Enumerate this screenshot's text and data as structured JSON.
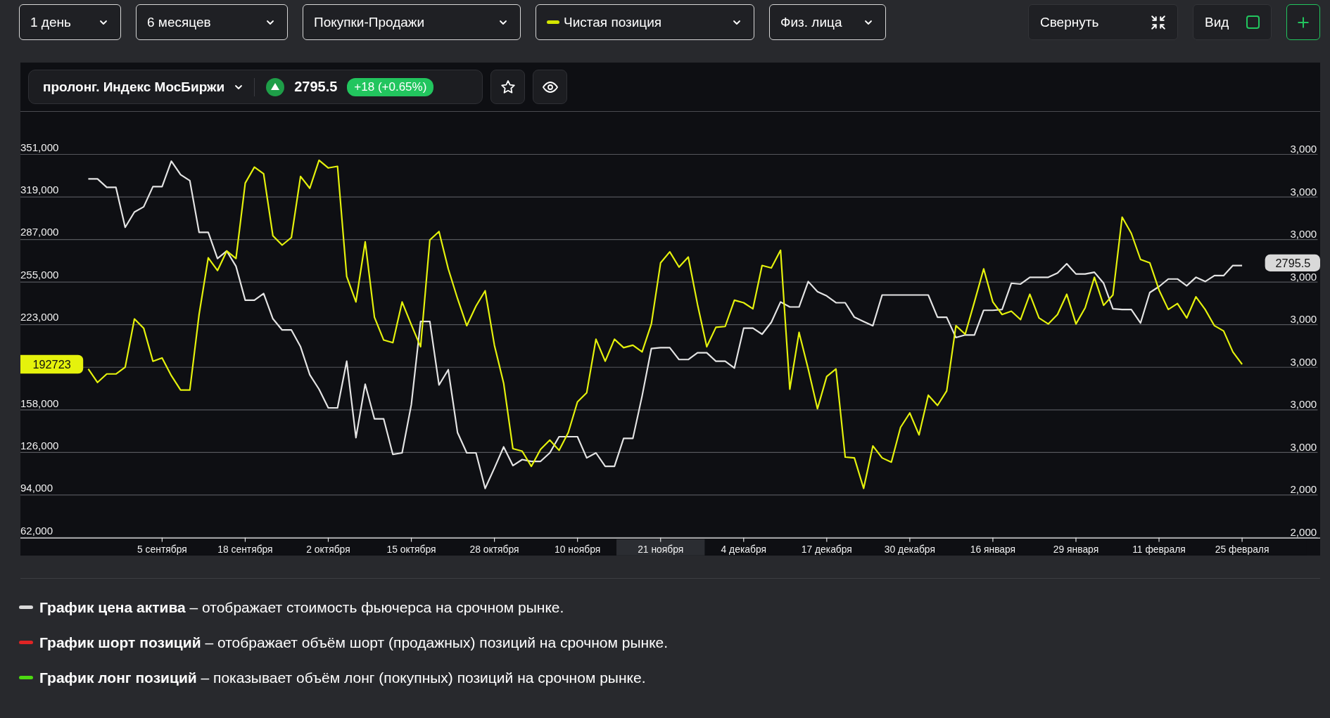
{
  "toolbar": {
    "filters": [
      {
        "label": "1 день",
        "kind": "plain"
      },
      {
        "label": "6 месяцев",
        "kind": "plain"
      },
      {
        "label": "Покупки-Продажи",
        "kind": "plain"
      },
      {
        "label": "Чистая позиция",
        "kind": "series",
        "color": "#d4e600"
      },
      {
        "label": "Физ. лица",
        "kind": "plain"
      }
    ],
    "collapse_button": {
      "label": "Свернуть"
    },
    "view_toggle": {
      "label": "Вид",
      "checked": false
    }
  },
  "instrument": {
    "name": "пролонг. Индекс МосБиржи",
    "rising": true,
    "price": "2795.5",
    "change": "+18 (+0.65%)"
  },
  "chart": {
    "chart_data": {
      "type": "line",
      "grid": true,
      "ylim": [
        62000,
        351000
      ],
      "categories": [
        null,
        null,
        null,
        null,
        null,
        null,
        null,
        null,
        "5 сентября",
        null,
        null,
        null,
        null,
        null,
        null,
        null,
        null,
        "18 сентября",
        null,
        null,
        null,
        null,
        null,
        null,
        null,
        null,
        "2 октября",
        null,
        null,
        null,
        null,
        null,
        null,
        null,
        null,
        "15 октября",
        null,
        null,
        null,
        null,
        null,
        null,
        null,
        null,
        "28 октября",
        null,
        null,
        null,
        null,
        null,
        null,
        null,
        null,
        "10 ноября",
        null,
        null,
        null,
        null,
        null,
        null,
        null,
        null,
        "21 ноября",
        null,
        null,
        null,
        null,
        null,
        null,
        null,
        null,
        "4 декабря",
        null,
        null,
        null,
        null,
        null,
        null,
        null,
        null,
        "17 декабря",
        null,
        null,
        null,
        null,
        null,
        null,
        null,
        null,
        "30 декабря",
        null,
        null,
        null,
        null,
        null,
        null,
        null,
        null,
        "16 января",
        null,
        null,
        null,
        null,
        null,
        null,
        null,
        null,
        "29 января",
        null,
        null,
        null,
        null,
        null,
        null,
        null,
        null,
        "11 февраля",
        null,
        null,
        null,
        null,
        null,
        null,
        null,
        null,
        "25 февраля"
      ],
      "yticks": [
        {
          "value": 351000,
          "label": "351,000"
        },
        {
          "value": 319000,
          "label": "319,000"
        },
        {
          "value": 287000,
          "label": "287,000"
        },
        {
          "value": 255000,
          "label": "255,000"
        },
        {
          "value": 223000,
          "label": "223,000"
        },
        {
          "value": 158000,
          "label": "158,000"
        },
        {
          "value": 126000,
          "label": "126,000"
        },
        {
          "value": 94000,
          "label": "94,000"
        },
        {
          "value": 62000,
          "label": "62,000"
        }
      ],
      "series": [
        {
          "color": "#e4e4e4",
          "values": [
            332500,
            332500,
            326100,
            326100,
            296000,
            307500,
            311400,
            326700,
            326700,
            345900,
            335700,
            331200,
            292200,
            292200,
            272400,
            278100,
            266600,
            241000,
            241000,
            246100,
            227000,
            218600,
            218600,
            205900,
            184800,
            173900,
            159800,
            159800,
            195000,
            137400,
            177700,
            151500,
            151500,
            124700,
            125900,
            162400,
            225000,
            225000,
            177100,
            188600,
            141300,
            125900,
            125900,
            99100,
            114400,
            130400,
            116300,
            120800,
            119500,
            119500,
            125900,
            138100,
            138100,
            138100,
            122100,
            125900,
            115700,
            115700,
            136800,
            136800,
            168800,
            204600,
            205200,
            205200,
            196300,
            196300,
            201400,
            201400,
            195000,
            195000,
            189900,
            219900,
            219900,
            215400,
            224400,
            239700,
            235900,
            235900,
            255100,
            247400,
            244200,
            239100,
            239100,
            228200,
            225000,
            221800,
            244900,
            244900,
            244900,
            244900,
            244900,
            244900,
            228200,
            228200,
            212900,
            214800,
            214800,
            233400,
            233400,
            234000,
            253800,
            253200,
            258300,
            258300,
            258300,
            261500,
            268500,
            260800,
            260800,
            262100,
            253800,
            234600,
            234000,
            234000,
            223800,
            246800,
            251300,
            257000,
            257000,
            251900,
            258300,
            255100,
            259600,
            259600,
            267200,
            267200
          ]
        },
        {
          "color": "#e5f20c",
          "values": [
            189200,
            179000,
            185400,
            185400,
            190500,
            226900,
            219900,
            195000,
            197500,
            184100,
            173300,
            173300,
            230200,
            273000,
            263400,
            278100,
            272400,
            329300,
            341400,
            336300,
            289600,
            282600,
            288300,
            334400,
            325400,
            346500,
            340800,
            342000,
            258900,
            239700,
            285100,
            228200,
            211000,
            209000,
            239700,
            222500,
            205900,
            286400,
            292800,
            264700,
            242300,
            221800,
            236600,
            248100,
            207100,
            178400,
            129100,
            127200,
            115700,
            128500,
            135500,
            127800,
            141300,
            164300,
            171300,
            211600,
            195000,
            211600,
            205200,
            207100,
            202000,
            223100,
            269200,
            277500,
            266000,
            273600,
            237800,
            205900,
            220600,
            221200,
            241000,
            239100,
            234600,
            267200,
            265300,
            278700,
            173900,
            216700,
            189200,
            159200,
            183500,
            189200,
            122700,
            122100,
            99100,
            131100,
            122100,
            118900,
            145100,
            156000,
            139400,
            169400,
            161700,
            172600,
            221800,
            215400,
            239700,
            264700,
            239700,
            230200,
            232700,
            226400,
            245500,
            227600,
            223100,
            230200,
            245500,
            223100,
            235300,
            258300,
            237200,
            244900,
            303700,
            291500,
            271700,
            269200,
            248700,
            234000,
            238500,
            227600,
            243600,
            234000,
            221800,
            217800,
            202000,
            192700
          ]
        }
      ]
    },
    "xtick_highlighted": [
      false,
      false,
      false,
      false,
      false,
      false,
      true,
      false,
      false,
      false,
      false,
      false,
      false,
      false
    ],
    "right_axis_labels": [
      "3,000",
      "3,000",
      "3,000",
      "3,000",
      "3,000",
      "3,000",
      "3,000",
      "3,000",
      "2,000",
      "2,000"
    ],
    "price_tag": "2795.5",
    "position_tag": "192723"
  },
  "legend": [
    {
      "text": "**График цена актива** – отображает стоимость фьючерса на срочном рынке.",
      "color": "#d9d9d9"
    },
    {
      "text": "**График шорт позиций** – отображает объём шорт (продажных) позиций на срочном рынке.",
      "color": "#e02424"
    },
    {
      "text": "**График лонг позиций** – показывает объём лонг (покупных) позиций на срочном рынке.",
      "color": "#4cd911"
    }
  ]
}
